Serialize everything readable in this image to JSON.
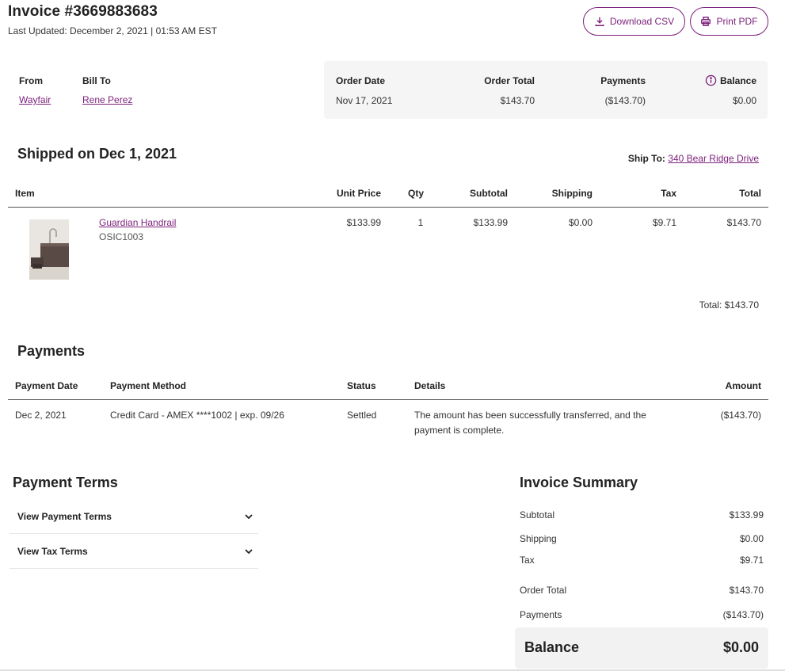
{
  "header": {
    "title": "Invoice #3669883683",
    "last_updated": "Last Updated: December 2, 2021 | 01:53 AM EST",
    "download_csv": "Download CSV",
    "print_pdf": "Print PDF"
  },
  "parties": {
    "from_label": "From",
    "from_value": "Wayfair",
    "bill_to_label": "Bill To",
    "bill_to_value": "Rene Perez"
  },
  "order_summary": {
    "order_date_label": "Order Date",
    "order_date": "Nov 17, 2021",
    "order_total_label": "Order Total",
    "order_total": "$143.70",
    "payments_label": "Payments",
    "payments": "($143.70)",
    "balance_label": "Balance",
    "balance": "$0.00"
  },
  "shipment": {
    "heading": "Shipped on Dec 1, 2021",
    "ship_to_label": "Ship To:",
    "ship_to_value": "340 Bear Ridge Drive",
    "columns": {
      "item": "Item",
      "unit_price": "Unit Price",
      "qty": "Qty",
      "subtotal": "Subtotal",
      "shipping": "Shipping",
      "tax": "Tax",
      "total": "Total"
    },
    "item": {
      "name": "Guardian Handrail",
      "sku": "OSIC1003",
      "unit_price": "$133.99",
      "qty": "1",
      "subtotal": "$133.99",
      "shipping": "$0.00",
      "tax": "$9.71",
      "total": "$143.70"
    },
    "total_line": "Total: $143.70"
  },
  "payments": {
    "heading": "Payments",
    "columns": {
      "date": "Payment Date",
      "method": "Payment Method",
      "status": "Status",
      "details": "Details",
      "amount": "Amount"
    },
    "row": {
      "date": "Dec 2, 2021",
      "method": "Credit Card - AMEX ****1002 | exp. 09/26",
      "status": "Settled",
      "details_line1": "The amount has been successfully transferred, and the",
      "details_line2": "payment is complete.",
      "amount": "($143.70)"
    }
  },
  "payment_terms": {
    "heading": "Payment Terms",
    "view_payment_terms": "View Payment Terms",
    "view_tax_terms": "View Tax Terms"
  },
  "invoice_summary": {
    "heading": "Invoice Summary",
    "subtotal_label": "Subtotal",
    "subtotal": "$133.99",
    "shipping_label": "Shipping",
    "shipping": "$0.00",
    "tax_label": "Tax",
    "tax": "$9.71",
    "order_total_label": "Order Total",
    "order_total": "$143.70",
    "payments_label": "Payments",
    "payments": "($143.70)",
    "balance_label": "Balance",
    "balance": "$0.00"
  },
  "colors": {
    "accent": "#7b1f7a",
    "panel": "#f5f5f5"
  }
}
